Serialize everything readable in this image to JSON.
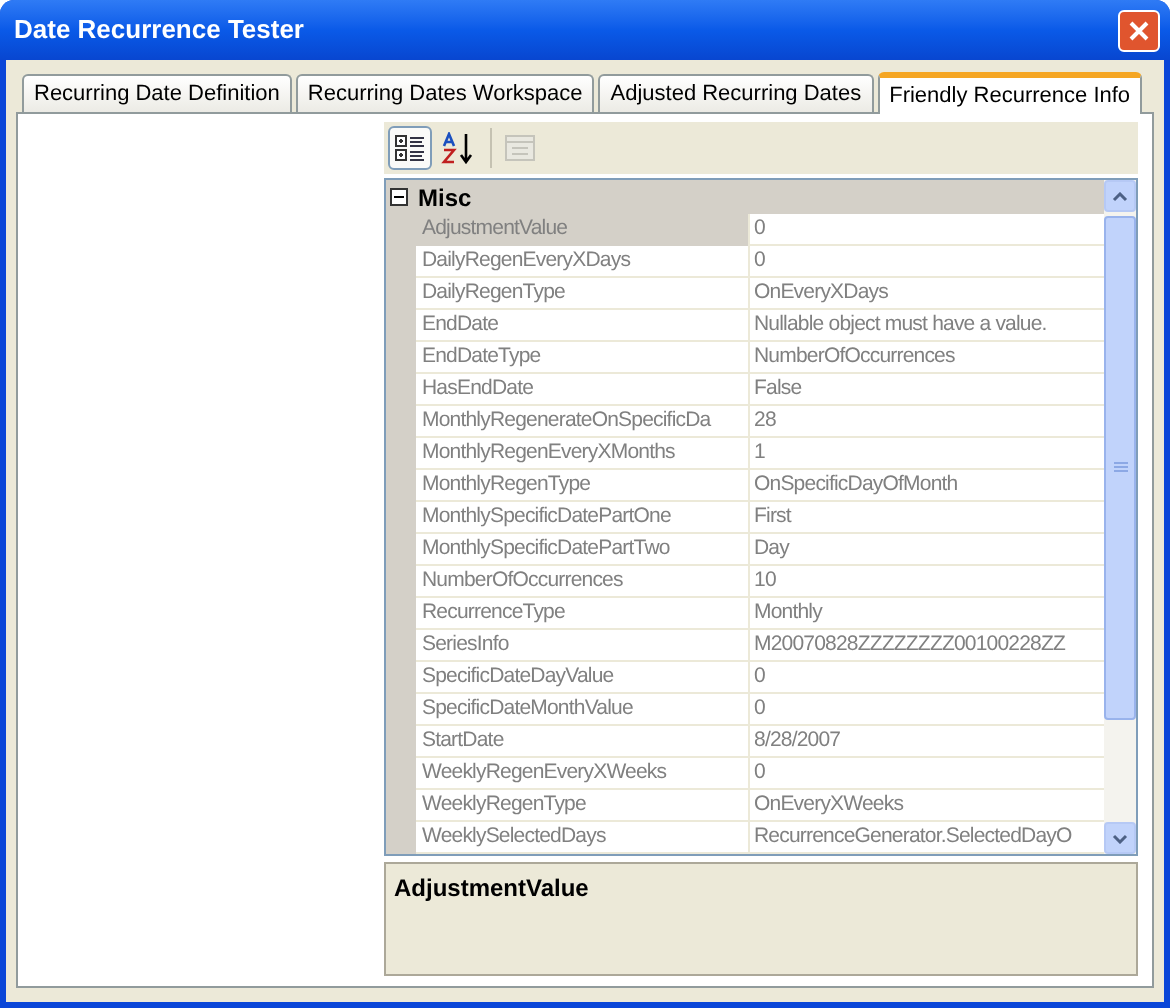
{
  "window": {
    "title": "Date Recurrence Tester"
  },
  "tabs": [
    {
      "label": "Recurring Date Definition",
      "selected": false
    },
    {
      "label": "Recurring Dates Workspace",
      "selected": false
    },
    {
      "label": "Adjusted Recurring Dates",
      "selected": false
    },
    {
      "label": "Friendly Recurrence Info",
      "selected": true
    }
  ],
  "toolbar": [
    {
      "kind": "categorized",
      "selected": true,
      "disabled": false
    },
    {
      "kind": "alphabetical",
      "selected": false,
      "disabled": false
    },
    {
      "kind": "property-pages",
      "selected": false,
      "disabled": true
    }
  ],
  "property_grid": {
    "category": {
      "label": "Misc",
      "expanded": true
    },
    "properties": [
      {
        "name": "AdjustmentValue",
        "value": "0",
        "selected": true
      },
      {
        "name": "DailyRegenEveryXDays",
        "value": "0",
        "selected": false
      },
      {
        "name": "DailyRegenType",
        "value": "OnEveryXDays",
        "selected": false
      },
      {
        "name": "EndDate",
        "value": "Nullable object must have a value.",
        "selected": false
      },
      {
        "name": "EndDateType",
        "value": "NumberOfOccurrences",
        "selected": false
      },
      {
        "name": "HasEndDate",
        "value": "False",
        "selected": false
      },
      {
        "name": "MonthlyRegenerateOnSpecificDa",
        "value": "28",
        "selected": false
      },
      {
        "name": "MonthlyRegenEveryXMonths",
        "value": "1",
        "selected": false
      },
      {
        "name": "MonthlyRegenType",
        "value": "OnSpecificDayOfMonth",
        "selected": false
      },
      {
        "name": "MonthlySpecificDatePartOne",
        "value": "First",
        "selected": false
      },
      {
        "name": "MonthlySpecificDatePartTwo",
        "value": "Day",
        "selected": false
      },
      {
        "name": "NumberOfOccurrences",
        "value": "10",
        "selected": false
      },
      {
        "name": "RecurrenceType",
        "value": "Monthly",
        "selected": false
      },
      {
        "name": "SeriesInfo",
        "value": "M20070828ZZZZZZZZ00100228ZZ",
        "selected": false
      },
      {
        "name": "SpecificDateDayValue",
        "value": "0",
        "selected": false
      },
      {
        "name": "SpecificDateMonthValue",
        "value": "0",
        "selected": false
      },
      {
        "name": "StartDate",
        "value": "8/28/2007",
        "selected": false
      },
      {
        "name": "WeeklyRegenEveryXWeeks",
        "value": "0",
        "selected": false
      },
      {
        "name": "WeeklyRegenType",
        "value": "OnEveryXWeeks",
        "selected": false
      },
      {
        "name": "WeeklySelectedDays",
        "value": "RecurrenceGenerator.SelectedDayO",
        "selected": false
      }
    ]
  },
  "description": {
    "title": "AdjustmentValue"
  }
}
